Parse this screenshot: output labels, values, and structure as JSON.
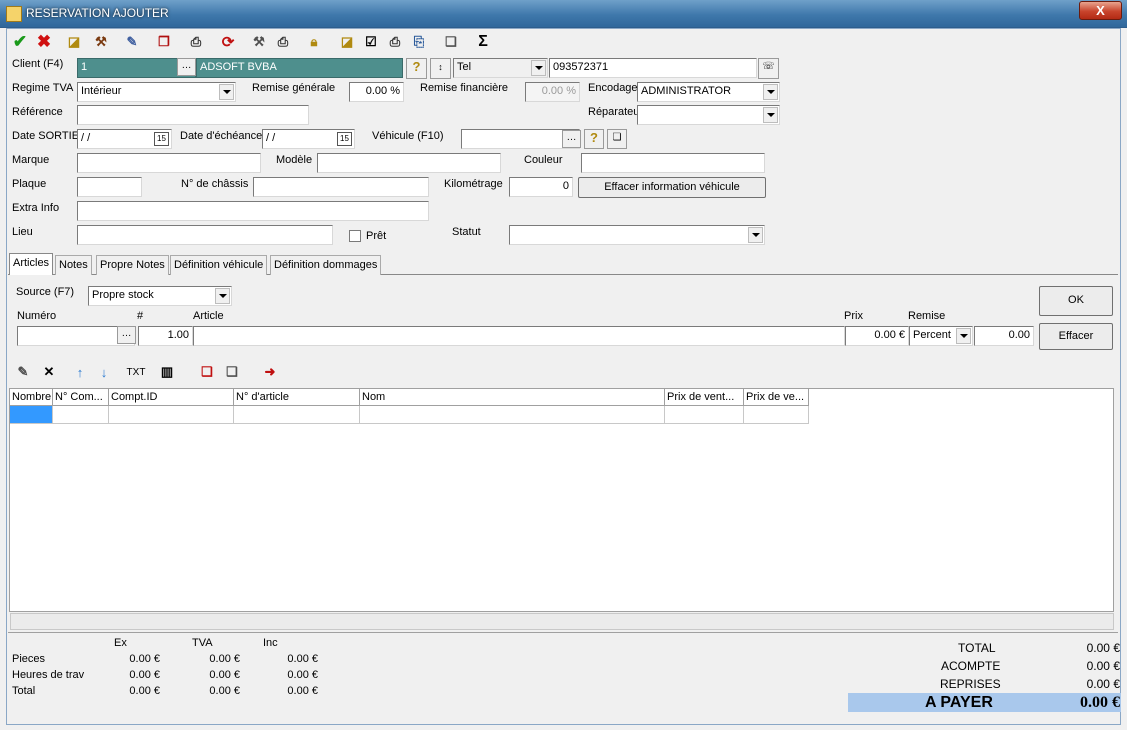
{
  "window": {
    "title": "RESERVATION AJOUTER",
    "close": "X"
  },
  "toolbar": {
    "sigma": "Σ"
  },
  "client": {
    "label": "Client (F4)",
    "id": "1",
    "name": "ADSOFT BVBA",
    "contact_type": "Tel",
    "phone": "093572371"
  },
  "regime": {
    "label": "Regime TVA",
    "value": "Intérieur"
  },
  "remise_generale": {
    "label": "Remise générale",
    "value": "0.00 %"
  },
  "remise_financiere": {
    "label": "Remise financière",
    "value": "0.00 %"
  },
  "encodage": {
    "label": "Encodage",
    "value": "ADMINISTRATOR"
  },
  "reparateur": {
    "label": "Réparateu",
    "value": ""
  },
  "reference": {
    "label": "Référence",
    "value": ""
  },
  "date_sortie": {
    "label": "Date SORTIE",
    "value": " / /"
  },
  "date_echeance": {
    "label": "Date d'échéance",
    "value": " / /"
  },
  "vehicule": {
    "label": "Véhicule (F10)",
    "value": ""
  },
  "marque": {
    "label": "Marque",
    "value": ""
  },
  "modele": {
    "label": "Modèle",
    "value": ""
  },
  "couleur": {
    "label": "Couleur",
    "value": ""
  },
  "plaque": {
    "label": "Plaque",
    "value": ""
  },
  "chassis": {
    "label": "N° de châssis",
    "value": ""
  },
  "kilometrage": {
    "label": "Kilométrage",
    "value": "0"
  },
  "effacer_vehicule": "Effacer information véhicule",
  "extra_info": {
    "label": "Extra Info",
    "value": ""
  },
  "lieu": {
    "label": "Lieu",
    "value": ""
  },
  "pret": {
    "label": "Prêt",
    "checked": false
  },
  "statut": {
    "label": "Statut",
    "value": ""
  },
  "tabs": [
    {
      "label": "Articles",
      "active": true
    },
    {
      "label": "Notes"
    },
    {
      "label": "Propre Notes"
    },
    {
      "label": "Définition véhicule"
    },
    {
      "label": "Définition dommages"
    }
  ],
  "articles": {
    "source": {
      "label": "Source (F7)",
      "value": "Propre stock"
    },
    "numero_label": "Numéro",
    "qty_label": "#",
    "article_label": "Article",
    "prix_label": "Prix",
    "remise_label": "Remise",
    "qty": "1.00",
    "prix": "0.00 €",
    "remise_type": "Percent",
    "remise_value": "0.00",
    "ok": "OK",
    "effacer": "Effacer",
    "txt": "TXT"
  },
  "grid": {
    "columns": [
      "Nombre",
      "N° Com...",
      "Compt.ID",
      "N° d'article",
      "Nom",
      "Prix de vent...",
      "Prix de ve..."
    ]
  },
  "summary": {
    "headers": [
      "Ex",
      "TVA",
      "Inc"
    ],
    "rows": [
      {
        "label": "Pieces",
        "ex": "0.00 €",
        "tva": "0.00 €",
        "inc": "0.00 €"
      },
      {
        "label": "Heures de trav",
        "ex": "0.00 €",
        "tva": "0.00 €",
        "inc": "0.00 €"
      },
      {
        "label": "Total",
        "ex": "0.00 €",
        "tva": "0.00 €",
        "inc": "0.00 €"
      }
    ]
  },
  "totals": {
    "total_label": "TOTAL",
    "total": "0.00 €",
    "acompte_label": "ACOMPTE",
    "acompte": "0.00 €",
    "reprises_label": "REPRISES",
    "reprises": "0.00 €",
    "apayer_label": "A PAYER",
    "apayer": "0.00 €"
  },
  "colors": {
    "accent": "#4e8f8d",
    "payer_bg": "#a9c8ec",
    "selected_cell": "#3399ff"
  }
}
